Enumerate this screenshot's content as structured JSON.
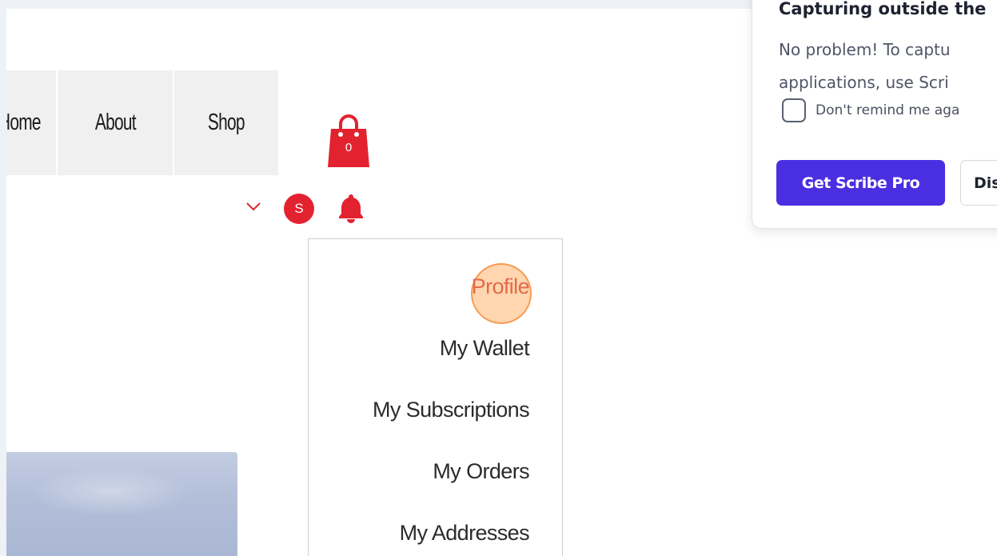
{
  "nav": {
    "home_label": "Home",
    "about_label": "About",
    "shop_label": "Shop"
  },
  "cart": {
    "count": "0",
    "icon": "shopping-bag-icon"
  },
  "user": {
    "avatar_initial": "S",
    "chevron_icon": "chevron-down-icon",
    "bell_icon": "bell-icon"
  },
  "dropdown": {
    "items": [
      {
        "label": "Profile"
      },
      {
        "label": "My Wallet"
      },
      {
        "label": "My Subscriptions"
      },
      {
        "label": "My Orders"
      },
      {
        "label": "My Addresses"
      }
    ]
  },
  "popup": {
    "title": "Capturing outside the",
    "body_line1": "No problem! To captu",
    "body_line2": "applications, use Scri",
    "checkbox_label": "Don't remind me aga",
    "pro_button": "Get Scribe Pro",
    "dismiss_button": "Dis"
  },
  "colors": {
    "accent": "#e3222f",
    "scribe_purple": "#4a2fe0",
    "active_item": "#e36a4b"
  }
}
